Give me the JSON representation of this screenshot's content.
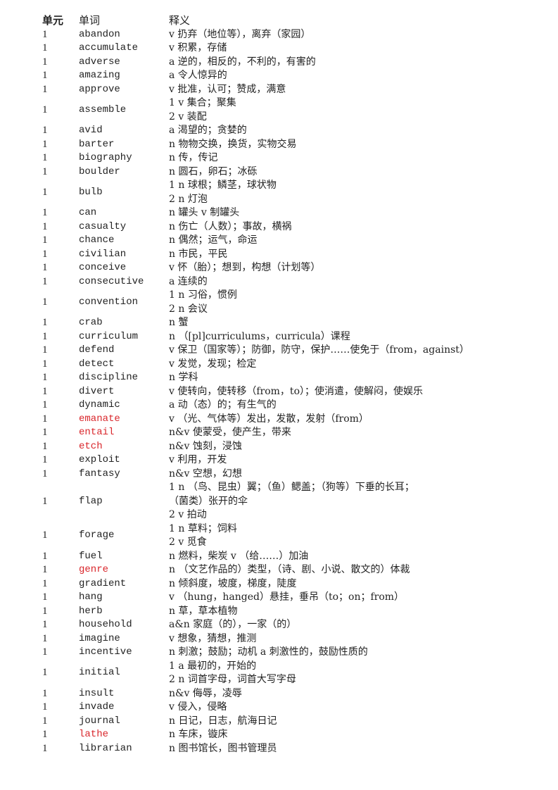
{
  "header": {
    "unit": "单元",
    "word": "单词",
    "definition": "释义"
  },
  "highlight_color": "#d9262b",
  "rows": [
    {
      "unit": "1",
      "word": "abandon",
      "red": false,
      "defs": [
        "v 扔弃（地位等），离弃（家园）"
      ]
    },
    {
      "unit": "1",
      "word": "accumulate",
      "red": false,
      "defs": [
        "v 积累，存储"
      ]
    },
    {
      "unit": "1",
      "word": "adverse",
      "red": false,
      "defs": [
        "a 逆的，相反的，不利的，有害的"
      ]
    },
    {
      "unit": "1",
      "word": "amazing",
      "red": false,
      "defs": [
        "a 令人惊异的"
      ]
    },
    {
      "unit": "1",
      "word": "approve",
      "red": false,
      "defs": [
        "v 批准，认可；赞成，满意"
      ]
    },
    {
      "unit": "1",
      "word": "assemble",
      "red": false,
      "defs": [
        "1 v 集合；聚集",
        "2 v 装配"
      ]
    },
    {
      "unit": "1",
      "word": "avid",
      "red": false,
      "defs": [
        "a 渴望的；贪婪的"
      ]
    },
    {
      "unit": "1",
      "word": "barter",
      "red": false,
      "defs": [
        "n 物物交换，换货，实物交易"
      ]
    },
    {
      "unit": "1",
      "word": "biography",
      "red": false,
      "defs": [
        "n 传，传记"
      ]
    },
    {
      "unit": "1",
      "word": "boulder",
      "red": false,
      "defs": [
        "n 圆石，卵石；冰砾"
      ]
    },
    {
      "unit": "1",
      "word": "bulb",
      "red": false,
      "defs": [
        "1 n 球根；鳞茎，球状物",
        "2 n 灯泡"
      ]
    },
    {
      "unit": "1",
      "word": "can",
      "red": false,
      "defs": [
        "n 罐头  v 制罐头"
      ]
    },
    {
      "unit": "1",
      "word": "casualty",
      "red": false,
      "defs": [
        "n 伤亡（人数）；事故，横祸"
      ]
    },
    {
      "unit": "1",
      "word": "chance",
      "red": false,
      "defs": [
        "n 偶然；运气，命运"
      ]
    },
    {
      "unit": "1",
      "word": "civilian",
      "red": false,
      "defs": [
        "n 市民，平民"
      ]
    },
    {
      "unit": "1",
      "word": "conceive",
      "red": false,
      "defs": [
        "v 怀（胎）；想到，构想（计划等）"
      ]
    },
    {
      "unit": "1",
      "word": "consecutive",
      "red": false,
      "defs": [
        "a 连续的"
      ]
    },
    {
      "unit": "1",
      "word": "convention",
      "red": false,
      "defs": [
        "1 n 习俗，惯例",
        "2 n 会议"
      ]
    },
    {
      "unit": "1",
      "word": "crab",
      "red": false,
      "defs": [
        "n 蟹"
      ]
    },
    {
      "unit": "1",
      "word": "curriculum",
      "red": false,
      "defs": [
        "n （[pl]curriculums，curricula）课程"
      ]
    },
    {
      "unit": "1",
      "word": "defend",
      "red": false,
      "defs": [
        "v 保卫（国家等）；防御，防守，保护……使免于（from，against）"
      ]
    },
    {
      "unit": "1",
      "word": "detect",
      "red": false,
      "defs": [
        "v 发觉，发现；检定"
      ]
    },
    {
      "unit": "1",
      "word": "discipline",
      "red": false,
      "defs": [
        "n 学科"
      ]
    },
    {
      "unit": "1",
      "word": "divert",
      "red": false,
      "defs": [
        "v 使转向，使转移（from，to）；使消遣，使解闷，使娱乐"
      ]
    },
    {
      "unit": "1",
      "word": "dynamic",
      "red": false,
      "defs": [
        "a 动（态）的；有生气的"
      ]
    },
    {
      "unit": "1",
      "word": "emanate",
      "red": true,
      "defs": [
        "v （光、气体等）发出，发散，发射（from）"
      ]
    },
    {
      "unit": "1",
      "word": "entail",
      "red": true,
      "defs": [
        "n&v 使蒙受，使产生，带来"
      ]
    },
    {
      "unit": "1",
      "word": "etch",
      "red": true,
      "defs": [
        "n&v 蚀刻，浸蚀"
      ]
    },
    {
      "unit": "1",
      "word": "exploit",
      "red": false,
      "defs": [
        "v 利用，开发"
      ]
    },
    {
      "unit": "1",
      "word": "fantasy",
      "red": false,
      "defs": [
        "n&v 空想，幻想"
      ]
    },
    {
      "unit": "1",
      "word": "flap",
      "red": false,
      "defs": [
        "1 n （鸟、昆虫）翼；（鱼）鳃盖；（狗等）下垂的长耳；",
        "（菌类）张开的伞",
        "2 v 拍动"
      ]
    },
    {
      "unit": "1",
      "word": "forage",
      "red": false,
      "defs": [
        "1 n 草料；饲料",
        "2 v 觅食"
      ]
    },
    {
      "unit": "1",
      "word": "fuel",
      "red": false,
      "defs": [
        "n 燃料，柴炭  v （给……）加油"
      ]
    },
    {
      "unit": "1",
      "word": "genre",
      "red": true,
      "defs": [
        "n （文艺作品的）类型，（诗、剧、小说、散文的）体裁"
      ]
    },
    {
      "unit": "1",
      "word": "gradient",
      "red": false,
      "defs": [
        "n 倾斜度，坡度，梯度，陡度"
      ]
    },
    {
      "unit": "1",
      "word": "hang",
      "red": false,
      "defs": [
        "v （hung，hanged）悬挂，垂吊（to；on；from）"
      ]
    },
    {
      "unit": "1",
      "word": "herb",
      "red": false,
      "defs": [
        "n 草，草本植物"
      ]
    },
    {
      "unit": "1",
      "word": "household",
      "red": false,
      "defs": [
        "a&n 家庭（的），一家（的）"
      ]
    },
    {
      "unit": "1",
      "word": "imagine",
      "red": false,
      "defs": [
        "v 想象，猜想，推测"
      ]
    },
    {
      "unit": "1",
      "word": "incentive",
      "red": false,
      "defs": [
        "n 刺激；鼓励；动机  a 刺激性的，鼓励性质的"
      ]
    },
    {
      "unit": "1",
      "word": "initial",
      "red": false,
      "defs": [
        "1 a 最初的，开始的",
        "2 n 词首字母，词首大写字母"
      ]
    },
    {
      "unit": "1",
      "word": "insult",
      "red": false,
      "defs": [
        "n&v 侮辱，凌辱"
      ]
    },
    {
      "unit": "1",
      "word": "invade",
      "red": false,
      "defs": [
        "v 侵入，侵略"
      ]
    },
    {
      "unit": "1",
      "word": "journal",
      "red": false,
      "defs": [
        "n 日记，日志，航海日记"
      ]
    },
    {
      "unit": "1",
      "word": "lathe",
      "red": true,
      "defs": [
        "n 车床，镟床"
      ]
    },
    {
      "unit": "1",
      "word": "librarian",
      "red": false,
      "defs": [
        "n 图书馆长，图书管理员"
      ]
    }
  ]
}
